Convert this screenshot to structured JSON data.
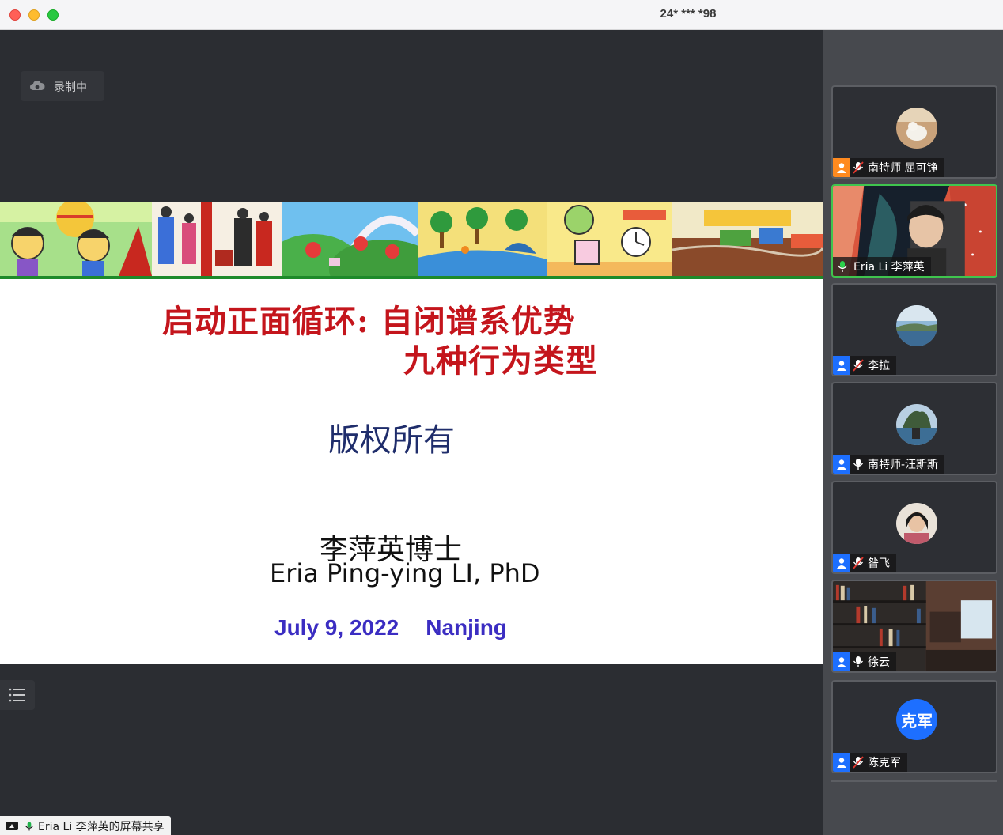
{
  "window": {
    "title": "24* *** *98"
  },
  "recording": {
    "label": "录制中",
    "icon": "cloud-icon"
  },
  "slide": {
    "title_line1": "启动正面循环: 自闭谱系优势",
    "title_line2": "九种行为类型",
    "copyright": "版权所有",
    "author_cn": "李萍英博士",
    "author_en": "Eria Ping-ying LI, PhD",
    "date": "July 9, 2022",
    "place": "Nanjing",
    "colors": {
      "title": "#c4151c",
      "copyright": "#1f2d6b",
      "date": "#3b2dc2",
      "banner_rule": "#1e8a2a"
    }
  },
  "share_label": {
    "text": "Eria Li 李萍英的屏幕共享"
  },
  "participants": [
    {
      "name": "南特师 屈可铮",
      "muted": true,
      "role_icon": "host-user-icon",
      "active": false,
      "avatar": "dog-photo"
    },
    {
      "name": "Eria Li 李萍英",
      "muted": false,
      "role_icon": "none",
      "active": true,
      "avatar": "video"
    },
    {
      "name": "李拉",
      "muted": true,
      "role_icon": "user-icon",
      "active": false,
      "avatar": "sea-photo"
    },
    {
      "name": "南特师-汪斯斯",
      "muted": false,
      "role_icon": "user-icon",
      "active": false,
      "avatar": "lake-photo"
    },
    {
      "name": "昝飞",
      "muted": true,
      "role_icon": "user-icon",
      "active": false,
      "avatar": "woman-photo"
    },
    {
      "name": "徐云",
      "muted": false,
      "role_icon": "user-icon",
      "active": false,
      "avatar": "bookshelf-background"
    },
    {
      "name": "陈克军",
      "muted": true,
      "role_icon": "user-icon",
      "active": false,
      "avatar": "initials",
      "initials": "克军"
    }
  ]
}
